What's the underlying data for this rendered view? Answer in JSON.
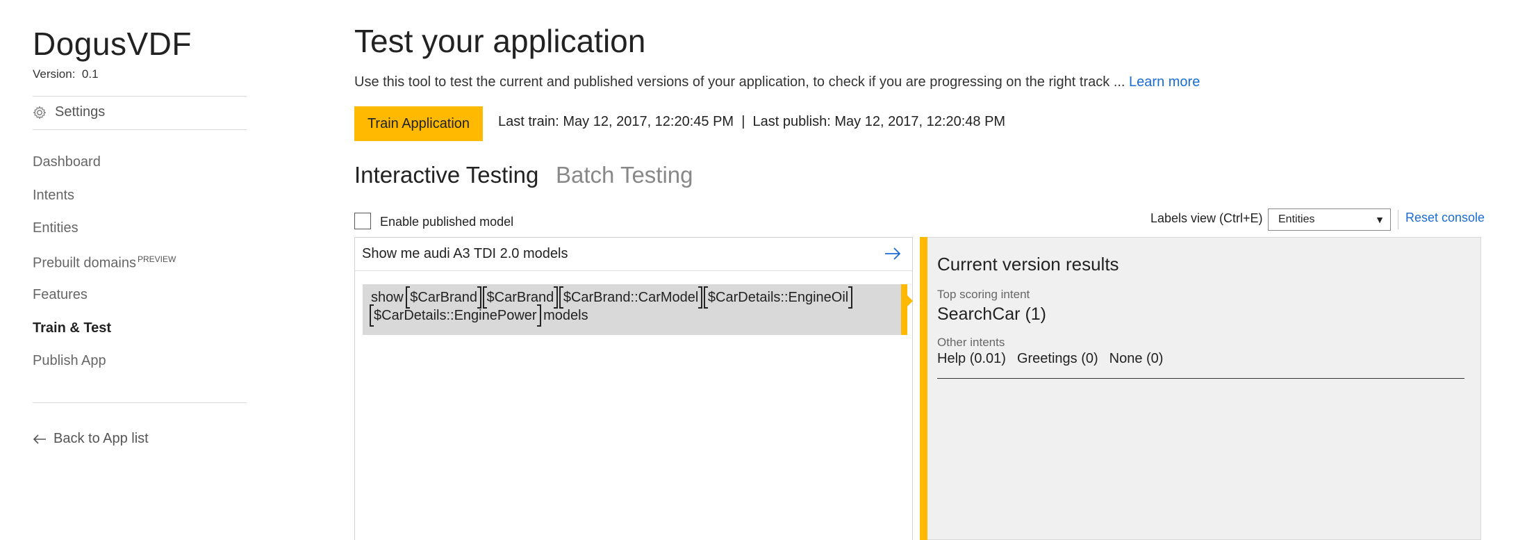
{
  "sidebar": {
    "app_name": "DogusVDF",
    "version_label": "Version:",
    "version_value": "0.1",
    "settings_label": "Settings",
    "nav": [
      {
        "label": "Dashboard"
      },
      {
        "label": "Intents"
      },
      {
        "label": "Entities"
      },
      {
        "label": "Prebuilt domains",
        "tag": "PREVIEW"
      },
      {
        "label": "Features"
      },
      {
        "label": "Train & Test",
        "active": true
      },
      {
        "label": "Publish App"
      }
    ],
    "back_label": "Back to App list"
  },
  "main": {
    "title": "Test your application",
    "description": "Use this tool to test the current and published versions of your application, to check if you are progressing on the right track ...",
    "learn_more": "Learn more",
    "train_button": "Train Application",
    "train_status": "Last train: May 12, 2017, 12:20:45 PM  |  Last publish: May 12, 2017, 12:20:48 PM",
    "tabs": [
      {
        "label": "Interactive Testing",
        "active": true
      },
      {
        "label": "Batch Testing",
        "active": false
      }
    ],
    "enable_published_label": "Enable published model",
    "labels_view_label": "Labels view (Ctrl+E)",
    "labels_view_value": "Entities",
    "reset_console": "Reset console"
  },
  "test": {
    "utterance": "Show me audi A3 TDI 2.0 models",
    "result_prefix": "show",
    "entities": [
      "$CarBrand",
      "$CarBrand",
      "$CarBrand::CarModel",
      "$CarDetails::EngineOil",
      "$CarDetails::EnginePower"
    ],
    "result_suffix": "models"
  },
  "results": {
    "title": "Current version results",
    "top_intent_label": "Top scoring intent",
    "top_intent": "SearchCar (1)",
    "other_intents_label": "Other intents",
    "other_intents": [
      "Help (0.01)",
      "Greetings (0)",
      "None (0)"
    ]
  },
  "colors": {
    "accent": "#ffb900",
    "link": "#1a6cd4",
    "results_bg": "#f0f0f0",
    "utterance_bg": "#d9d9d9"
  },
  "icons": [
    "gear-icon",
    "arrow-right-icon",
    "arrow-left-icon",
    "dropdown-arrow-icon"
  ]
}
